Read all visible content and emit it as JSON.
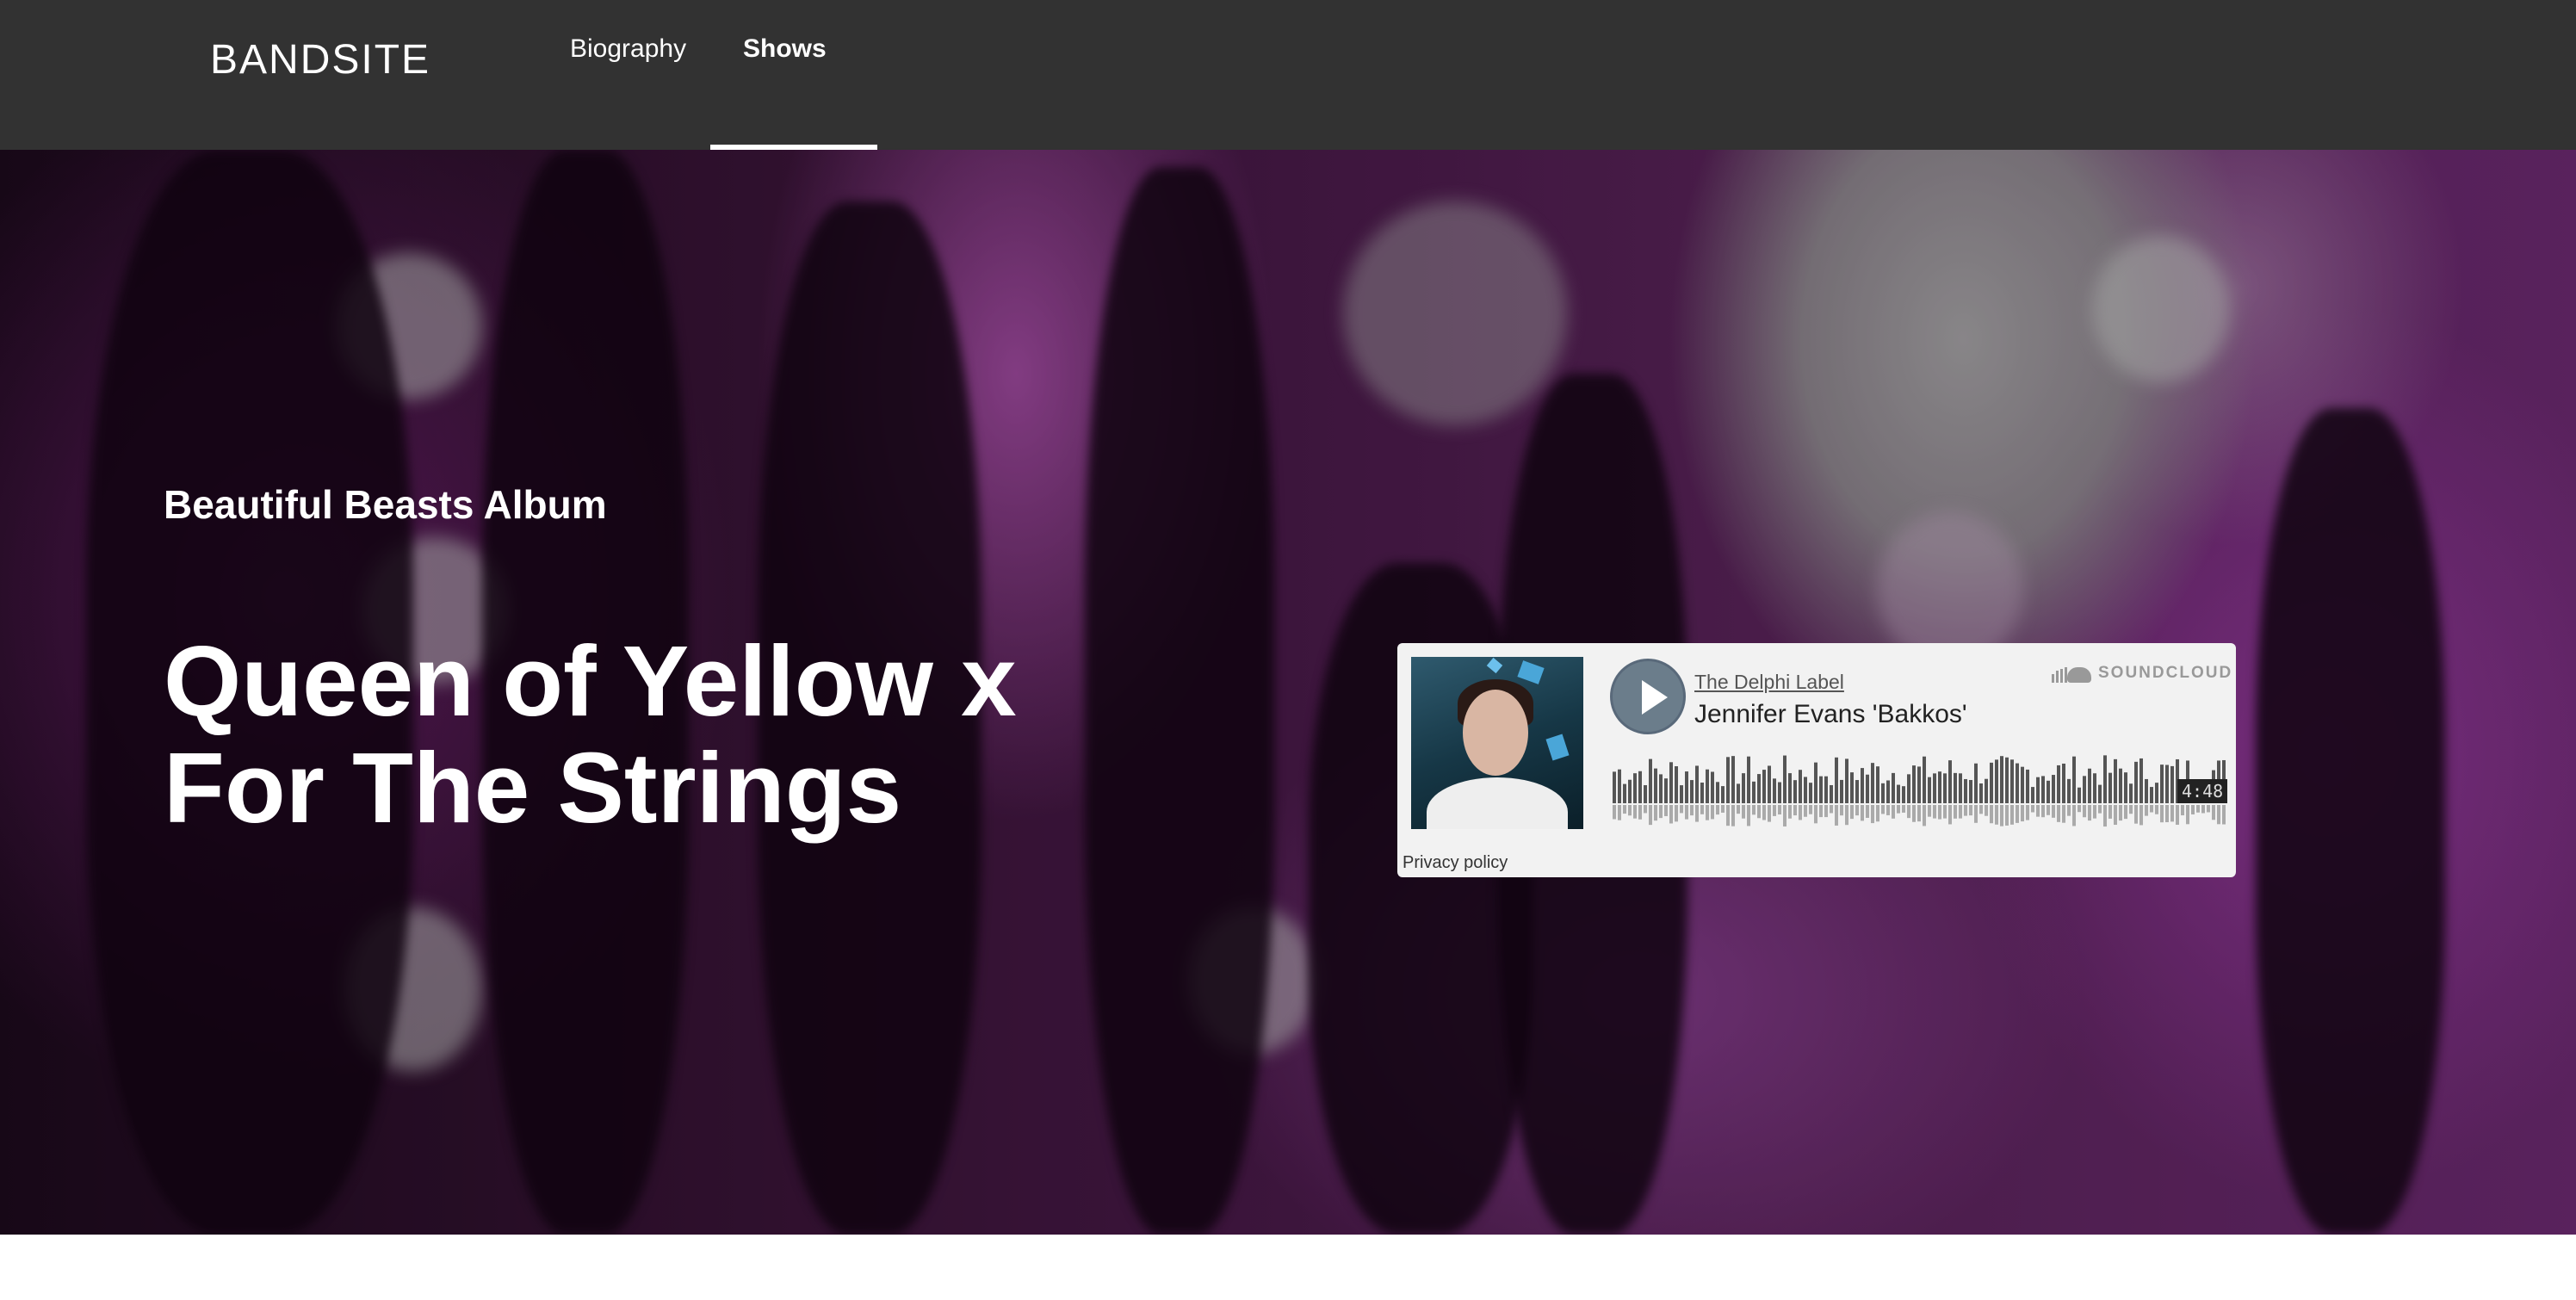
{
  "header": {
    "logo": "BANDSITE",
    "nav": [
      {
        "label": "Biography",
        "active": false
      },
      {
        "label": "Shows",
        "active": true
      }
    ]
  },
  "hero": {
    "subtitle": "Beautiful Beasts Album",
    "title_line1": "Queen of Yellow x",
    "title_line2": "For The Strings"
  },
  "player": {
    "label": "The Delphi Label",
    "track": "Jennifer Evans 'Bakkos'",
    "brand": "SOUNDCLOUD",
    "duration": "4:48",
    "privacy": "Privacy policy",
    "icons": {
      "play": "play-icon",
      "brand": "soundcloud-cloud-icon"
    }
  },
  "colors": {
    "header_bg": "#323232",
    "accent_purple": "#7a2a7a",
    "widget_bg": "#f2f2f2",
    "wave_top": "#555555",
    "wave_bottom": "#aaaaaa"
  }
}
